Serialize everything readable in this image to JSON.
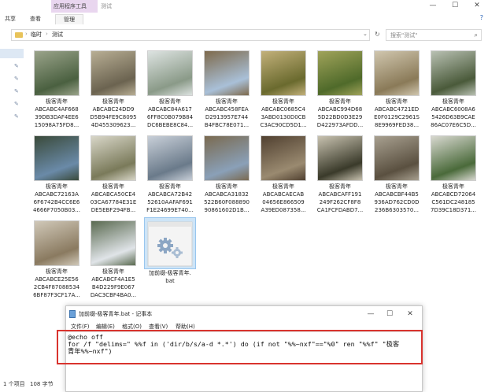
{
  "ribbon": {
    "context_group": "应用程序工具",
    "window_title": "测试",
    "tabs": [
      "共享",
      "查看",
      "管理"
    ],
    "help_glyph": "?"
  },
  "window_controls": {
    "minimize": "—",
    "maximize": "☐",
    "close": "✕"
  },
  "address": {
    "crumb_sep": "›",
    "crumbs": [
      "临时",
      "测试"
    ],
    "dropdown_glyph": "⌄",
    "refresh_glyph": "↻"
  },
  "search": {
    "placeholder": "搜索\"测试\"",
    "icon_glyph": "⌕"
  },
  "files": [
    {
      "title": "极客青年",
      "name1": "ABCABC4AF668",
      "name2": "39DB3DAF4EE6",
      "name3": "15098A75FD8...",
      "thumb": [
        "#4a6040",
        "#9aa38a"
      ]
    },
    {
      "title": "极客青年",
      "name1": "ABCABC24DD9",
      "name2": "D5B94FE9C8095",
      "name3": "4D455309623...",
      "thumb": [
        "#6b6350",
        "#b8ae94"
      ]
    },
    {
      "title": "极客青年",
      "name1": "ABCABC84A617",
      "name2": "6FF8C0B079B84",
      "name3": "DC6BEBE8C84...",
      "thumb": [
        "#8a9a88",
        "#dde3e1"
      ]
    },
    {
      "title": "极客青年",
      "name1": "ABCABC458FEA",
      "name2": "D2913957E744",
      "name3": "B4FBC78E071...",
      "thumb": [
        "#a9c0d8",
        "#7e6a4c"
      ]
    },
    {
      "title": "极客青年",
      "name1": "ABCABC0685C4",
      "name2": "3ABD0130D0CB",
      "name3": "C3AC90CD5D1...",
      "thumb": [
        "#6a6a2e",
        "#c2b07a"
      ]
    },
    {
      "title": "极客青年",
      "name1": "ABCABC994D68",
      "name2": "5D22BD0D3E29",
      "name3": "D422973AFDD...",
      "thumb": [
        "#4f6a2a",
        "#a0a35a"
      ]
    },
    {
      "title": "极客青年",
      "name1": "ABCABC4721ED",
      "name2": "E0F0129C2961S",
      "name3": "8E9969FED38...",
      "thumb": [
        "#8a7a58",
        "#d0c6ae"
      ]
    },
    {
      "title": "极客青年",
      "name1": "ABCABC6008A6",
      "name2": "5426D63B9CAE",
      "name3": "86AC07E6C5D...",
      "thumb": [
        "#4a5a3a",
        "#b8c0b2"
      ]
    },
    {
      "title": "极客青年",
      "name1": "ABCABC72163A",
      "name2": "6F6742B4CC6E6",
      "name3": "4666F7050B03...",
      "thumb": [
        "#6a8aa8",
        "#3a4a3a"
      ]
    },
    {
      "title": "极客青年",
      "name1": "ABCABCA50CE4",
      "name2": "03CA67784E31E",
      "name3": "DE5EBF294FB...",
      "thumb": [
        "#7a7a5a",
        "#d8d6c8"
      ]
    },
    {
      "title": "极客青年",
      "name1": "ABCABCA72B42",
      "name2": "52610AAFAF691",
      "name3": "F1E24699E740...",
      "thumb": [
        "#6a7a8a",
        "#c8cfd8"
      ]
    },
    {
      "title": "极客青年",
      "name1": "ABCABCA31832",
      "name2": "522B60F088890",
      "name3": "90861602D1B...",
      "thumb": [
        "#8aa0b8",
        "#7a6a50"
      ]
    },
    {
      "title": "极客青年",
      "name1": "ABCABCAECAB",
      "name2": "04656E866509",
      "name3": "A39ED087358...",
      "thumb": [
        "#9a8a70",
        "#504030"
      ]
    },
    {
      "title": "极客青年",
      "name1": "ABCABCAFF191",
      "name2": "249F262CF8F8",
      "name3": "CA1FCFDABD7...",
      "thumb": [
        "#3a3a2a",
        "#c8c2b0"
      ]
    },
    {
      "title": "极客青年",
      "name1": "ABCABCBF44B5",
      "name2": "936AD762CD0D",
      "name3": "236B6303570...",
      "thumb": [
        "#5a5040",
        "#a8a090"
      ]
    },
    {
      "title": "极客青年",
      "name1": "ABCABCD72064",
      "name2": "C561DC248185",
      "name3": "7D39C18D371...",
      "thumb": [
        "#4a6a3a",
        "#d8d8d0"
      ]
    },
    {
      "title": "极客青年",
      "name1": "ABCABCE25E56",
      "name2": "2CB4F87088534",
      "name3": "6BF87F3CF17A...",
      "thumb": [
        "#8a7a60",
        "#d0c8b8"
      ]
    },
    {
      "title": "极客青年",
      "name1": "ABCABCF4A1E5",
      "name2": "B4D229F9E067",
      "name3": "DAC3CBF4BA0...",
      "thumb": [
        "#e0e4e8",
        "#5a6a50"
      ]
    }
  ],
  "bat_file": {
    "name1": "加前缀-极客青年.",
    "name2": "bat"
  },
  "status": {
    "count": "1 个项目",
    "selected": "108 字节"
  },
  "notepad": {
    "title": "加前缀-极客青年.bat - 记事本",
    "menu": [
      "文件(F)",
      "编辑(E)",
      "格式(O)",
      "查看(V)",
      "帮助(H)"
    ],
    "lines": [
      "@echo off",
      "for /f \"delims=\" %%f in ('dir/b/s/a-d *.*') do (if not \"%%~nxf\"==\"%0\" ren \"%%f\" \"极客",
      "青年%%~nxf\")"
    ]
  }
}
